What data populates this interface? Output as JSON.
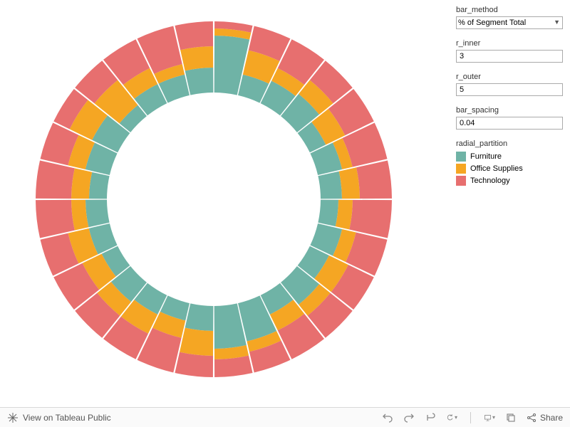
{
  "controls": {
    "bar_method": {
      "label": "bar_method",
      "value": "% of Segment Total"
    },
    "r_inner": {
      "label": "r_inner",
      "value": "3"
    },
    "r_outer": {
      "label": "r_outer",
      "value": "5"
    },
    "bar_spacing": {
      "label": "bar_spacing",
      "value": "0.04"
    }
  },
  "legend": {
    "title": "radial_partition",
    "items": [
      {
        "label": "Furniture",
        "color": "#6fb3a6"
      },
      {
        "label": "Office Supplies",
        "color": "#f5a623"
      },
      {
        "label": "Technology",
        "color": "#e76f6f"
      }
    ]
  },
  "toolbar": {
    "view_label": "View on Tableau Public",
    "share_label": "Share"
  },
  "chart_data": {
    "type": "pie",
    "title": "",
    "r_inner": 3,
    "r_outer": 5,
    "bar_spacing": 0.04,
    "bar_method": "% of Segment Total",
    "series": [
      {
        "name": "Furniture",
        "color": "#6fb3a6"
      },
      {
        "name": "Office Supplies",
        "color": "#f5a623"
      },
      {
        "name": "Technology",
        "color": "#e76f6f"
      }
    ],
    "segments": [
      {
        "furniture": 0.8,
        "office": 0.1,
        "tech": 0.1
      },
      {
        "furniture": 0.3,
        "office": 0.35,
        "tech": 0.35
      },
      {
        "furniture": 0.35,
        "office": 0.2,
        "tech": 0.45
      },
      {
        "furniture": 0.4,
        "office": 0.25,
        "tech": 0.35
      },
      {
        "furniture": 0.25,
        "office": 0.3,
        "tech": 0.45
      },
      {
        "furniture": 0.35,
        "office": 0.15,
        "tech": 0.5
      },
      {
        "furniture": 0.3,
        "office": 0.25,
        "tech": 0.45
      },
      {
        "furniture": 0.25,
        "office": 0.2,
        "tech": 0.55
      },
      {
        "furniture": 0.35,
        "office": 0.2,
        "tech": 0.45
      },
      {
        "furniture": 0.3,
        "office": 0.3,
        "tech": 0.4
      },
      {
        "furniture": 0.4,
        "office": 0.2,
        "tech": 0.4
      },
      {
        "furniture": 0.3,
        "office": 0.25,
        "tech": 0.45
      },
      {
        "furniture": 0.55,
        "office": 0.15,
        "tech": 0.3
      },
      {
        "furniture": 0.6,
        "office": 0.15,
        "tech": 0.25
      },
      {
        "furniture": 0.35,
        "office": 0.35,
        "tech": 0.3
      },
      {
        "furniture": 0.25,
        "office": 0.25,
        "tech": 0.5
      },
      {
        "furniture": 0.3,
        "office": 0.3,
        "tech": 0.4
      },
      {
        "furniture": 0.35,
        "office": 0.25,
        "tech": 0.4
      },
      {
        "furniture": 0.25,
        "office": 0.3,
        "tech": 0.45
      },
      {
        "furniture": 0.3,
        "office": 0.3,
        "tech": 0.4
      },
      {
        "furniture": 0.3,
        "office": 0.2,
        "tech": 0.5
      },
      {
        "furniture": 0.25,
        "office": 0.25,
        "tech": 0.5
      },
      {
        "furniture": 0.35,
        "office": 0.25,
        "tech": 0.4
      },
      {
        "furniture": 0.4,
        "office": 0.35,
        "tech": 0.25
      },
      {
        "furniture": 0.2,
        "office": 0.45,
        "tech": 0.35
      },
      {
        "furniture": 0.3,
        "office": 0.25,
        "tech": 0.45
      },
      {
        "furniture": 0.3,
        "office": 0.15,
        "tech": 0.55
      },
      {
        "furniture": 0.35,
        "office": 0.3,
        "tech": 0.35
      }
    ]
  }
}
